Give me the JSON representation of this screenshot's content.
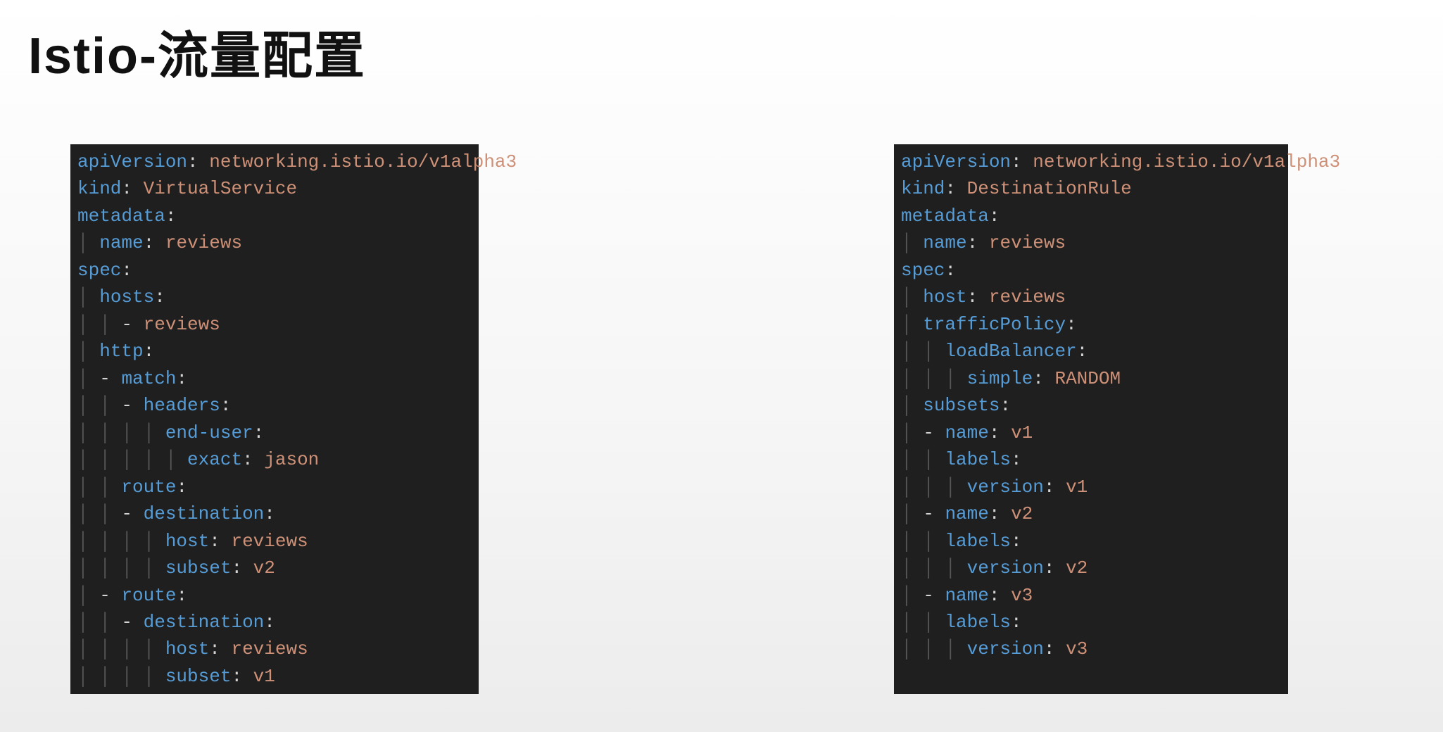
{
  "title": "Istio-流量配置",
  "left_yaml": {
    "apiVersion": "networking.istio.io/v1alpha3",
    "kind": "VirtualService",
    "metadata": {
      "name": "reviews"
    },
    "spec": {
      "hosts": [
        "reviews"
      ],
      "http": [
        {
          "match": [
            {
              "headers": {
                "end-user": {
                  "exact": "jason"
                }
              }
            }
          ],
          "route": [
            {
              "destination": {
                "host": "reviews",
                "subset": "v2"
              }
            }
          ]
        },
        {
          "route": [
            {
              "destination": {
                "host": "reviews",
                "subset": "v1"
              }
            }
          ]
        }
      ]
    }
  },
  "right_yaml": {
    "apiVersion": "networking.istio.io/v1alpha3",
    "kind": "DestinationRule",
    "metadata": {
      "name": "reviews"
    },
    "spec": {
      "host": "reviews",
      "trafficPolicy": {
        "loadBalancer": {
          "simple": "RANDOM"
        }
      },
      "subsets": [
        {
          "name": "v1",
          "labels": {
            "version": "v1"
          }
        },
        {
          "name": "v2",
          "labels": {
            "version": "v2"
          }
        },
        {
          "name": "v3",
          "labels": {
            "version": "v3"
          }
        }
      ]
    }
  }
}
